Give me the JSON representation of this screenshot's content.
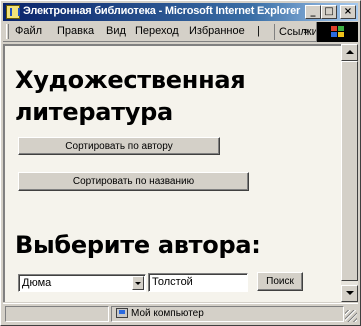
{
  "window": {
    "title": "Электронная библиотека - Microsoft Internet Explorer",
    "buttons": {
      "minimize": "_",
      "maximize": "□",
      "close": "×"
    }
  },
  "menubar": {
    "items": [
      {
        "label": "Файл"
      },
      {
        "label": "Правка"
      },
      {
        "label": "Вид"
      },
      {
        "label": "Переход"
      },
      {
        "label": "Избранное"
      }
    ],
    "overflow": "|",
    "links": "Ссылки",
    "links_arrow": "»"
  },
  "page": {
    "heading": "Художественная литература",
    "sort_by_author": "Сортировать по автору",
    "sort_by_title": "Сортировать  по названию",
    "author_heading": "Выберите автора:",
    "author_select": {
      "selected": "Дюма"
    },
    "author_input": {
      "value": "Толстой"
    },
    "search_button": "Поиск"
  },
  "statusbar": {
    "zone": "Мой компьютер"
  }
}
